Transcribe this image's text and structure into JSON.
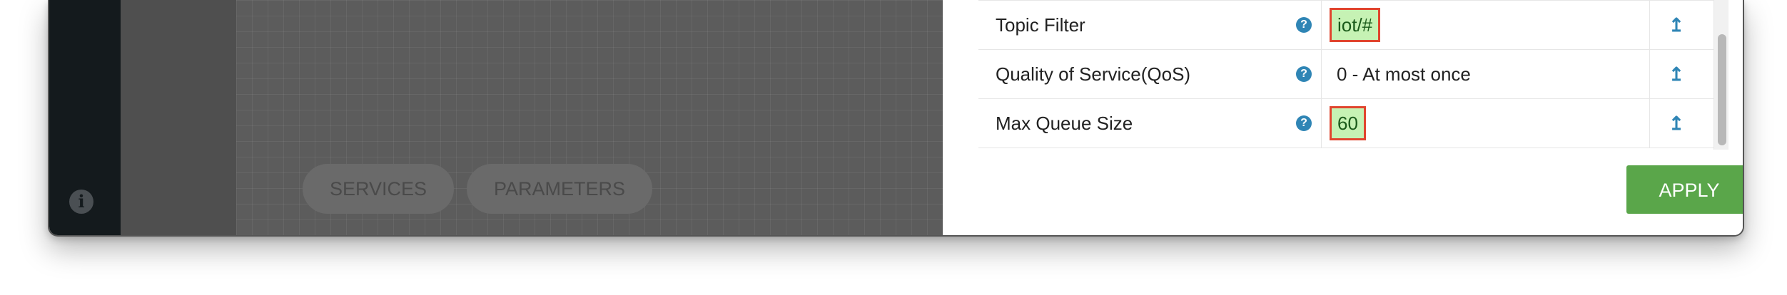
{
  "sidebar": {
    "info_icon": "info-icon"
  },
  "canvas": {
    "tabs": [
      {
        "label": "SERVICES"
      },
      {
        "label": "PARAMETERS"
      }
    ]
  },
  "panel": {
    "rows": [
      {
        "label": "Topic Filter",
        "value": "iot/#",
        "highlighted": true,
        "help_icon": "question-circle-icon",
        "reset_icon": "reset-arrow-icon"
      },
      {
        "label": "Quality of Service(QoS)",
        "value": "0 - At most once",
        "highlighted": false,
        "help_icon": "question-circle-icon",
        "reset_icon": "reset-arrow-icon"
      },
      {
        "label": "Max Queue Size",
        "value": "60",
        "highlighted": true,
        "help_icon": "question-circle-icon",
        "reset_icon": "reset-arrow-icon"
      }
    ],
    "apply_label": "APPLY"
  },
  "colors": {
    "accent": "#2f85b5",
    "apply": "#5aa64a",
    "highlight_fill": "#c6f2b4",
    "highlight_border": "#e0452e"
  }
}
